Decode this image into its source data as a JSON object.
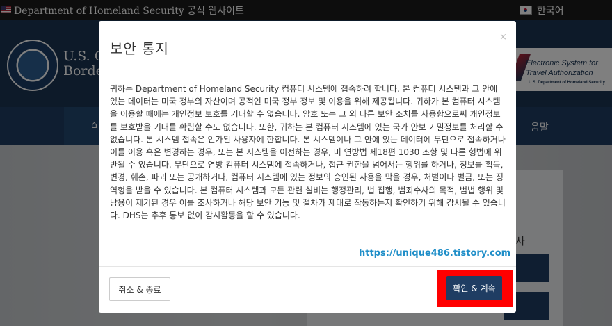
{
  "topbar": {
    "site_label": "Department of Homeland Security 공식 웹사이트",
    "language": "한국어"
  },
  "header": {
    "agency_line1": "U.S. C",
    "agency_line2": "Borde",
    "esta_line1": "Electronic System for",
    "esta_line2": "Travel Authorization",
    "esta_line3": "U.S. Department of Homeland Security"
  },
  "nav": {
    "help_partial": "움말"
  },
  "hero": {
    "partial_char": "사"
  },
  "modal": {
    "title": "보안 통지",
    "close": "×",
    "body": "귀하는 Department of Homeland Security 컴퓨터 시스템에 접속하려 합니다. 본 컴퓨터 시스템과 그 안에 있는 데이터는 미국 정부의 자산이며 공적인 미국 정부 정보 및 이용을 위해 제공됩니다. 귀하가 본 컴퓨터 시스템을 이용할 때에는 개인정보 보호를 기대할 수 없습니다. 암호 또는 그 외 다른 보안 조치를 사용함으로써 개인정보를 보호받을 기대를 확립할 수도 없습니다. 또한, 귀하는 본 컴퓨터 시스템에 있는 국가 안보 기밀정보를 처리할 수 없습니다. 본 시스템 접속은 인가된 사용자에 한합니다. 본 시스템이나 그 안에 있는 데이터에 무단으로 접속하거나 이를 이용 혹은 변경하는 경우, 또는 본 시스템을 이전하는 경우, 미 연방법 제18편 1030 조항 및 다른 형법에 위반될 수 있습니다. 무단으로 연방 컴퓨터 시스템에 접속하거나, 접근 권한을 넘어서는 행위를 하거나, 정보를 획득, 변경, 훼손, 파괴 또는 공개하거나, 컴퓨터 시스템에 있는 정보의 승인된 사용을 막을 경우, 처벌이나 벌금, 또는 징역형을 받을 수 있습니다. 본 컴퓨터 시스템과 모든 관련 설비는 행정관리, 법 집행, 범죄수사의 목적, 범법 행위 및 남용이 제기된 경우 이를 조사하거나 해당 보안 기능 및 절차가 제대로 작동하는지 확인하기 위해 감시될 수 있습니다. DHS는 추후 통보 없이 감시활동을 할 수 있습니다.",
    "watermark": "https://unique486.tistory.com",
    "cancel_label": "취소 & 종료",
    "confirm_label": "확인 & 계속"
  },
  "colors": {
    "navy": "#1f3d63",
    "highlight": "#ff0000",
    "watermark": "#1f8ec8"
  }
}
